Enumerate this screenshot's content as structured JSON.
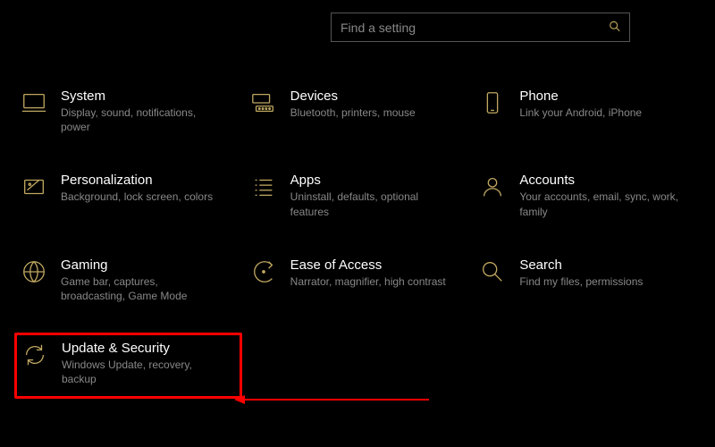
{
  "search": {
    "placeholder": "Find a setting"
  },
  "tiles": {
    "system": {
      "title": "System",
      "desc": "Display, sound, notifications, power"
    },
    "devices": {
      "title": "Devices",
      "desc": "Bluetooth, printers, mouse"
    },
    "phone": {
      "title": "Phone",
      "desc": "Link your Android, iPhone"
    },
    "personalization": {
      "title": "Personalization",
      "desc": "Background, lock screen, colors"
    },
    "apps": {
      "title": "Apps",
      "desc": "Uninstall, defaults, optional features"
    },
    "accounts": {
      "title": "Accounts",
      "desc": "Your accounts, email, sync, work, family"
    },
    "gaming": {
      "title": "Gaming",
      "desc": "Game bar, captures, broadcasting, Game Mode"
    },
    "ease": {
      "title": "Ease of Access",
      "desc": "Narrator, magnifier, high contrast"
    },
    "search": {
      "title": "Search",
      "desc": "Find my files, permissions"
    },
    "update": {
      "title": "Update & Security",
      "desc": "Windows Update, recovery, backup"
    }
  },
  "colors": {
    "accent": "#c0a860",
    "annotation": "#ff0000"
  }
}
